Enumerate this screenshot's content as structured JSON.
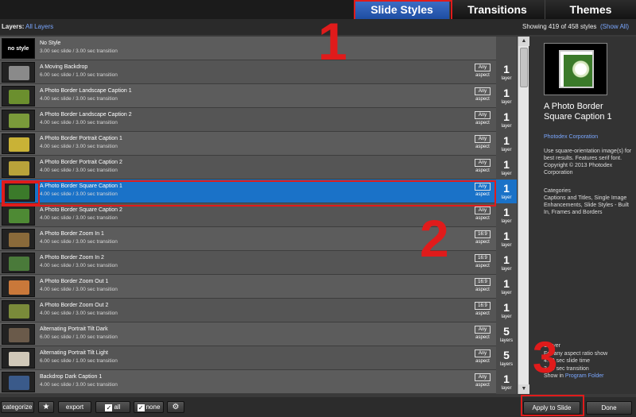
{
  "tabs": [
    {
      "label": "Slide Styles",
      "active": true
    },
    {
      "label": "Transitions",
      "active": false
    },
    {
      "label": "Themes",
      "active": false
    }
  ],
  "filter": {
    "label": "Layers:",
    "value": "All Layers",
    "showing": "Showing 419 of 458 styles",
    "show_all": "(Show All)"
  },
  "rows": [
    {
      "title": "No Style",
      "sub": "3.00 sec slide / 3.00 sec transition",
      "thumb_text": "no style",
      "aspect": "",
      "layers": "",
      "layer_word": "",
      "thumb_color": "#000"
    },
    {
      "title": "A Moving Backdrop",
      "sub": "6.00 sec slide / 1.00 sec transition",
      "aspect": "Any",
      "layers": "1",
      "layer_word": "layer",
      "thumb_color": "#8a8a8a"
    },
    {
      "title": "A Photo Border Landscape Caption 1",
      "sub": "4.00 sec slide / 3.00 sec transition",
      "aspect": "Any",
      "layers": "1",
      "layer_word": "layer",
      "thumb_color": "#6b8f2e"
    },
    {
      "title": "A Photo Border Landscape Caption 2",
      "sub": "4.00 sec slide / 3.00 sec transition",
      "aspect": "Any",
      "layers": "1",
      "layer_word": "layer",
      "thumb_color": "#7a9a3a"
    },
    {
      "title": "A Photo Border Portrait Caption 1",
      "sub": "4.00 sec slide / 3.00 sec transition",
      "aspect": "Any",
      "layers": "1",
      "layer_word": "layer",
      "thumb_color": "#c9b236"
    },
    {
      "title": "A Photo Border Portrait Caption 2",
      "sub": "4.00 sec slide / 3.00 sec transition",
      "aspect": "Any",
      "layers": "1",
      "layer_word": "layer",
      "thumb_color": "#b8a23a"
    },
    {
      "title": "A Photo Border Square Caption 1",
      "sub": "4.00 sec slide / 3.00 sec transition",
      "aspect": "Any",
      "layers": "1",
      "layer_word": "layer",
      "thumb_color": "#3b7a2a",
      "selected": true
    },
    {
      "title": "A Photo Border Square Caption 2",
      "sub": "4.00 sec slide / 3.00 sec transition",
      "aspect": "Any",
      "layers": "1",
      "layer_word": "layer",
      "thumb_color": "#4e8a34"
    },
    {
      "title": "A Photo Border Zoom In 1",
      "sub": "4.00 sec slide / 3.00 sec transition",
      "aspect": "16:9",
      "layers": "1",
      "layer_word": "layer",
      "thumb_color": "#8a6a3a"
    },
    {
      "title": "A Photo Border Zoom In 2",
      "sub": "4.00 sec slide / 3.00 sec transition",
      "aspect": "16:9",
      "layers": "1",
      "layer_word": "layer",
      "thumb_color": "#4a7a3a"
    },
    {
      "title": "A Photo Border Zoom Out 1",
      "sub": "4.00 sec slide / 3.00 sec transition",
      "aspect": "16:9",
      "layers": "1",
      "layer_word": "layer",
      "thumb_color": "#c9783a"
    },
    {
      "title": "A Photo Border Zoom Out 2",
      "sub": "4.00 sec slide / 3.00 sec transition",
      "aspect": "16:9",
      "layers": "1",
      "layer_word": "layer",
      "thumb_color": "#7a8a3a"
    },
    {
      "title": "Alternating Portrait Tilt Dark",
      "sub": "6.00 sec slide / 1.00 sec transition",
      "aspect": "Any",
      "layers": "5",
      "layer_word": "layers",
      "thumb_color": "#6a5a4a"
    },
    {
      "title": "Alternating Portrait Tilt Light",
      "sub": "6.00 sec slide / 1.00 sec transition",
      "aspect": "Any",
      "layers": "5",
      "layer_word": "layers",
      "thumb_color": "#d0c8b8"
    },
    {
      "title": "Backdrop Dark Caption 1",
      "sub": "4.00 sec slide / 3.00 sec transition",
      "aspect": "Any",
      "layers": "1",
      "layer_word": "layer",
      "thumb_color": "#3a5a8a"
    }
  ],
  "aspect_label": "aspect",
  "detail": {
    "title": "A Photo Border Square Caption 1",
    "author": "Photodex Corporation",
    "description": "Use square-orientation image(s) for best results. Features serif font. Copyright © 2013 Photodex Corporation",
    "categories_label": "Categories",
    "categories": "Captions and Titles, Single Image Enhancements, Slide Styles - Built In, Frames and Borders",
    "spec_layers": "1 layer",
    "spec_aspect": "For any aspect ratio show",
    "spec_slide": "4.00 sec slide time",
    "spec_transition": "3.00 sec transition",
    "spec_folder_prefix": "Show in",
    "spec_folder_link": "Program Folder"
  },
  "toolbar": {
    "categorize": "categorize",
    "star": "★",
    "export": "export",
    "all": "all",
    "none": "none",
    "gear": "⚙",
    "apply": "Apply to Slide",
    "done": "Done",
    "check": "✓"
  },
  "scroll": {
    "up": "▲",
    "down": "▼"
  },
  "annotations": {
    "one": "1",
    "two": "2",
    "three": "3"
  },
  "colors": {
    "accent": "#1a72c8",
    "highlight": "#e01b1b",
    "link": "#7aa7ff"
  }
}
